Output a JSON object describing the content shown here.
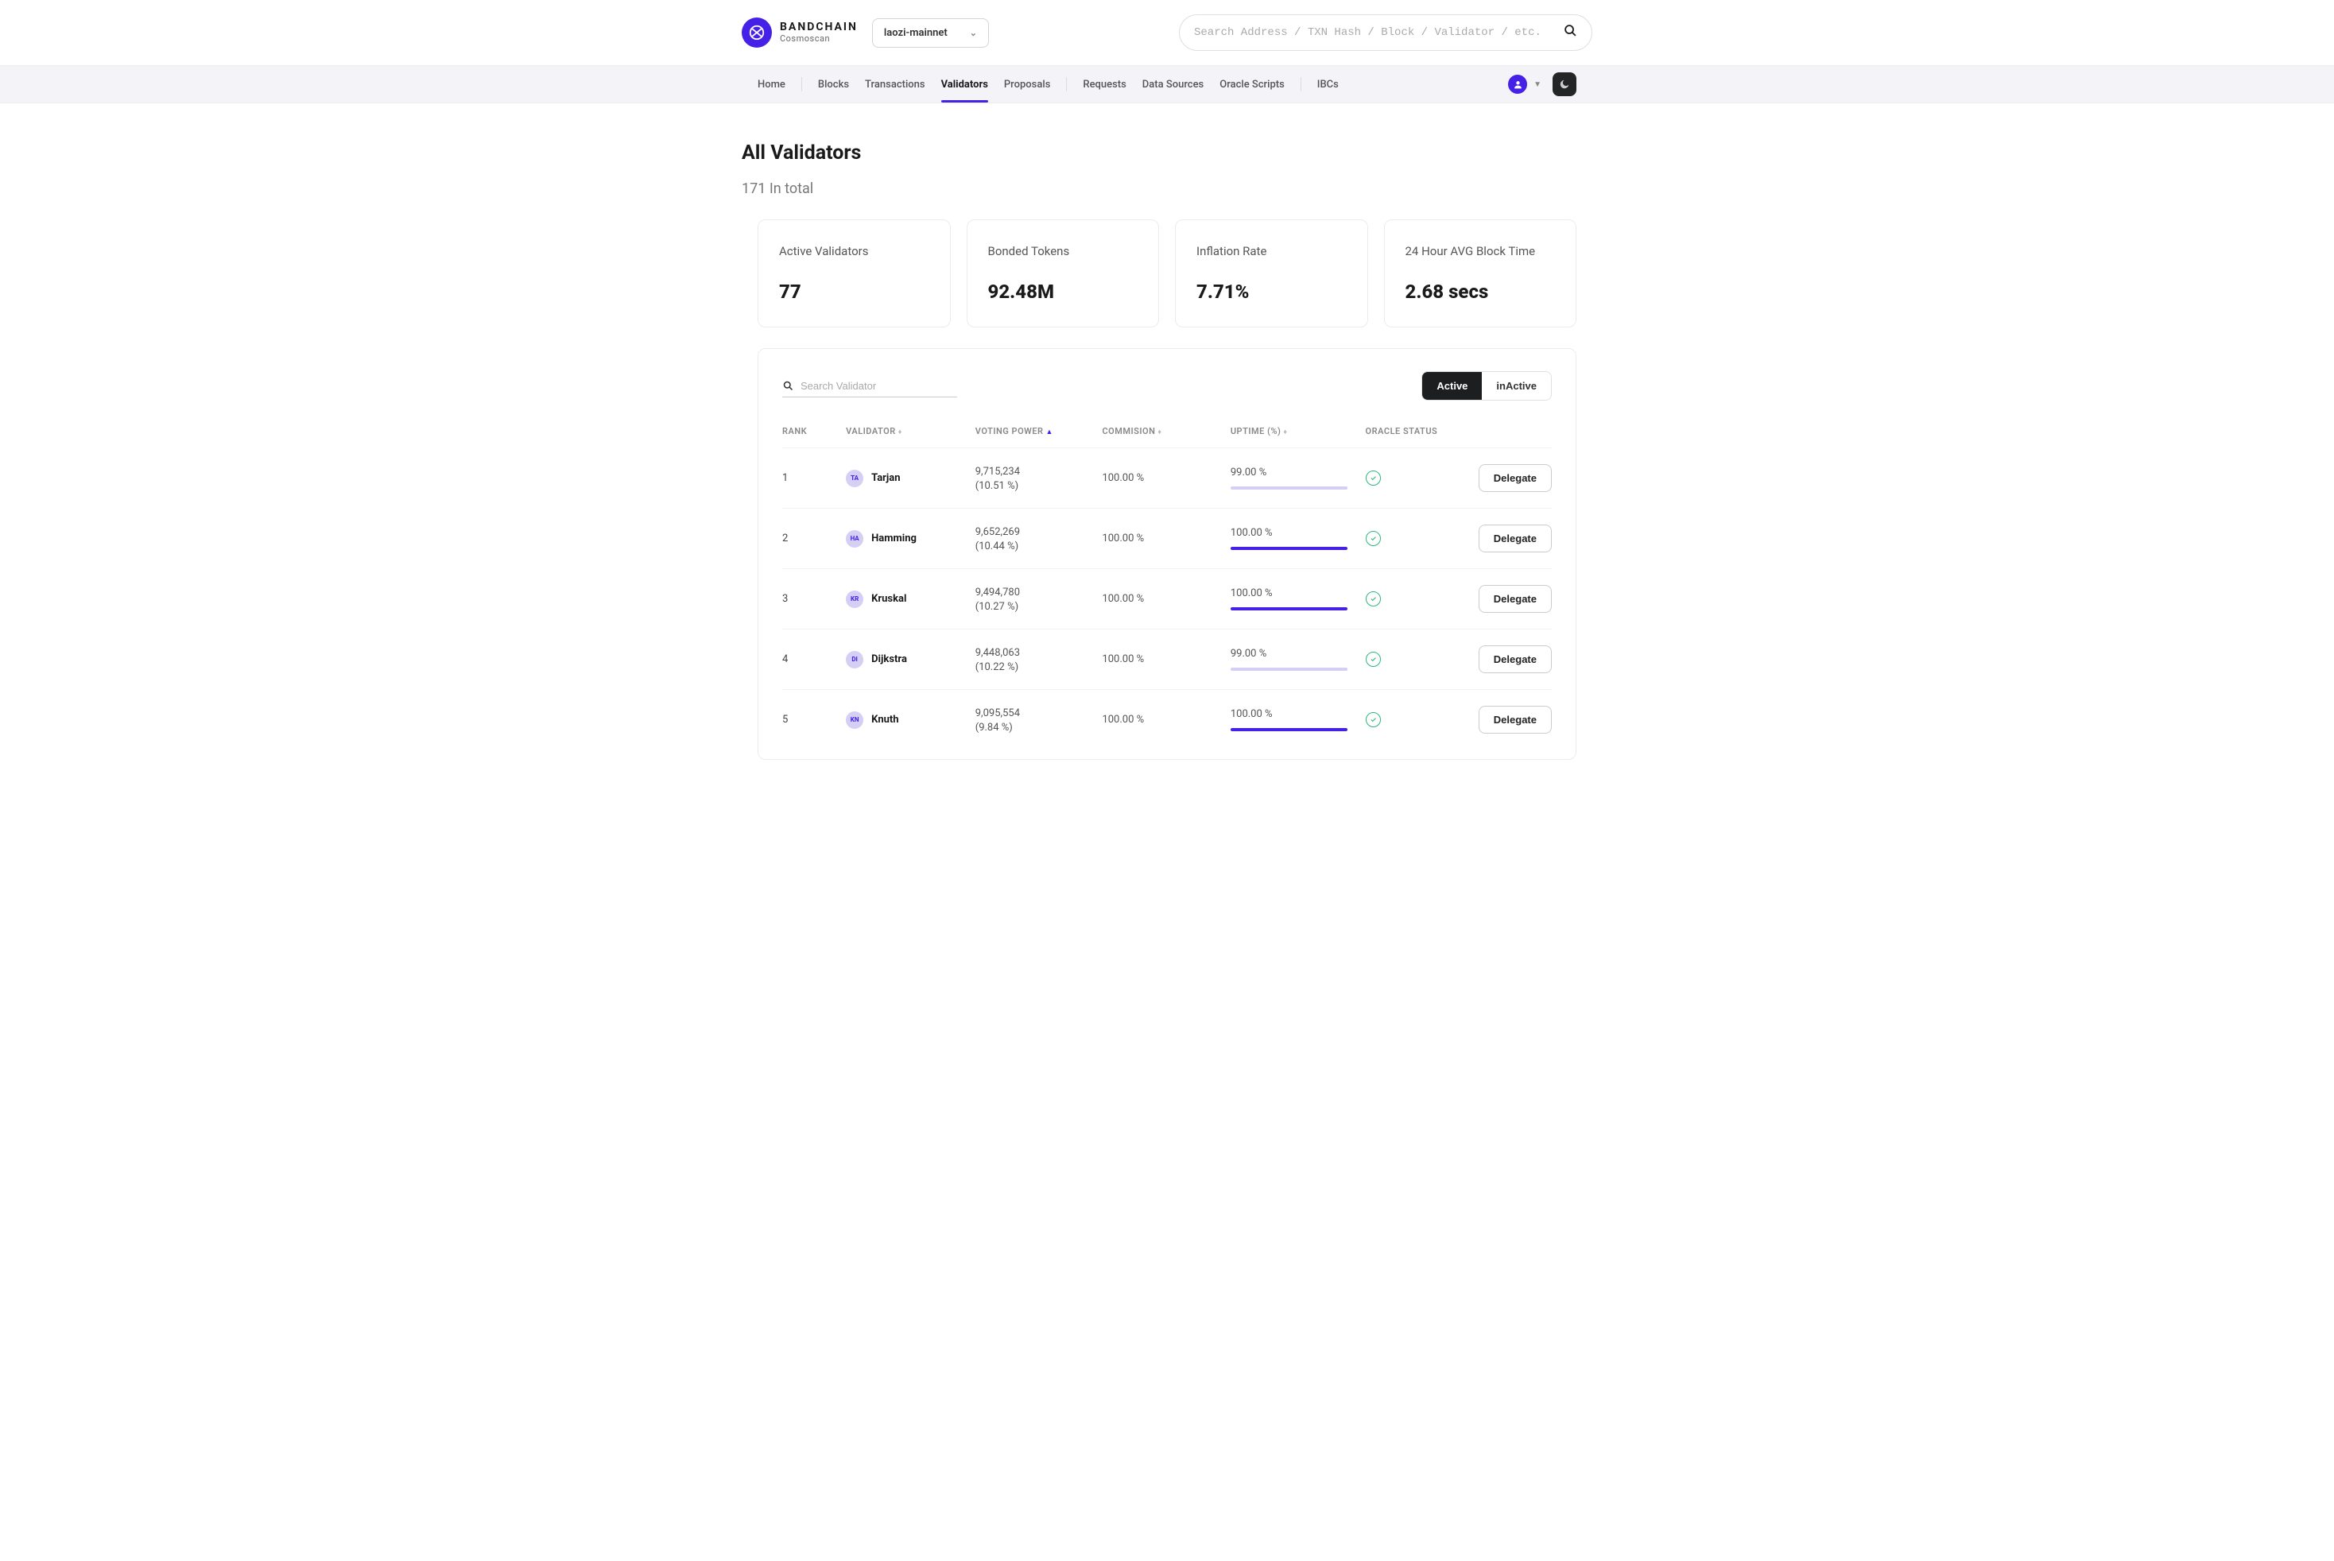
{
  "brand": {
    "top": "BANDCHAIN",
    "bottom": "Cosmoscan"
  },
  "network": "laozi-mainnet",
  "search_placeholder": "Search Address / TXN Hash / Block / Validator / etc.",
  "nav": {
    "home": "Home",
    "blocks": "Blocks",
    "transactions": "Transactions",
    "validators": "Validators",
    "proposals": "Proposals",
    "requests": "Requests",
    "data_sources": "Data Sources",
    "oracle_scripts": "Oracle Scripts",
    "ibcs": "IBCs"
  },
  "page": {
    "title": "All Validators",
    "subtitle": "171 In total"
  },
  "stats": {
    "active": {
      "label": "Active Validators",
      "value": "77"
    },
    "bonded": {
      "label": "Bonded Tokens",
      "value": "92.48M"
    },
    "inflation": {
      "label": "Inflation Rate",
      "value": "7.71%"
    },
    "blocktime": {
      "label": "24 Hour AVG Block Time",
      "value": "2.68 secs"
    }
  },
  "table": {
    "search_placeholder": "Search Validator",
    "toggle": {
      "active": "Active",
      "inactive": "inActive"
    },
    "headers": {
      "rank": "RANK",
      "validator": "VALIDATOR",
      "voting_power": "VOTING POWER",
      "commission": "COMMISION",
      "uptime": "UPTIME (%)",
      "oracle": "ORACLE STATUS"
    },
    "delegate_label": "Delegate",
    "rows": [
      {
        "rank": "1",
        "avatar": "TA",
        "name": "Tarjan",
        "vp": "9,715,234",
        "vp_pct": "(10.51 %)",
        "commission": "100.00 %",
        "uptime": "99.00 %",
        "uptime_fill": 0
      },
      {
        "rank": "2",
        "avatar": "HA",
        "name": "Hamming",
        "vp": "9,652,269",
        "vp_pct": "(10.44 %)",
        "commission": "100.00 %",
        "uptime": "100.00 %",
        "uptime_fill": 100
      },
      {
        "rank": "3",
        "avatar": "KR",
        "name": "Kruskal",
        "vp": "9,494,780",
        "vp_pct": "(10.27 %)",
        "commission": "100.00 %",
        "uptime": "100.00 %",
        "uptime_fill": 100
      },
      {
        "rank": "4",
        "avatar": "DI",
        "name": "Dijkstra",
        "vp": "9,448,063",
        "vp_pct": "(10.22 %)",
        "commission": "100.00 %",
        "uptime": "99.00 %",
        "uptime_fill": 0
      },
      {
        "rank": "5",
        "avatar": "KN",
        "name": "Knuth",
        "vp": "9,095,554",
        "vp_pct": "(9.84 %)",
        "commission": "100.00 %",
        "uptime": "100.00 %",
        "uptime_fill": 100
      }
    ]
  }
}
